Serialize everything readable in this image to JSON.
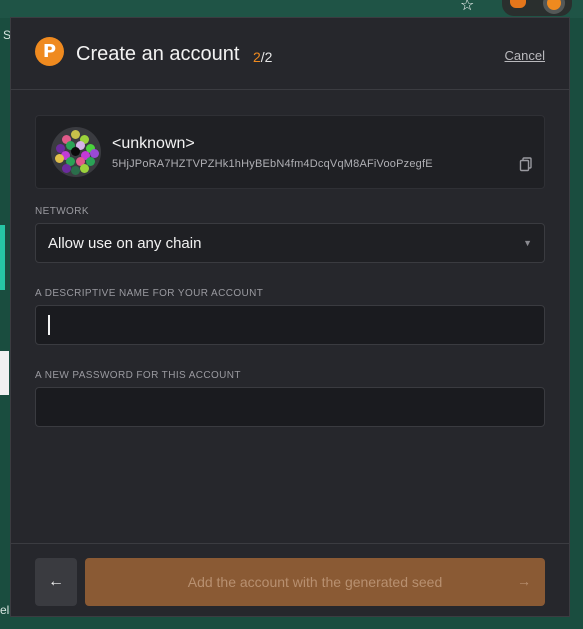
{
  "browser": {
    "bg_text_left": "S",
    "bg_text_bottom": "ela",
    "star_icon": "star-icon"
  },
  "header": {
    "title": "Create an account",
    "step_current": "2",
    "step_total": "/2",
    "cancel_label": "Cancel"
  },
  "account": {
    "name": "<unknown>",
    "address": "5HjJPoRA7HZTVPZHk1hHyBEbN4fm4DcqVqM8AFiVooPzegfE",
    "copy_icon": "copy-icon"
  },
  "network": {
    "label": "NETWORK",
    "selected": "Allow use on any chain"
  },
  "name_field": {
    "label": "A DESCRIPTIVE NAME FOR YOUR ACCOUNT",
    "value": ""
  },
  "password_field": {
    "label": "A NEW PASSWORD FOR THIS ACCOUNT",
    "value": ""
  },
  "footer": {
    "back_icon": "arrow-left-icon",
    "add_label": "Add the account with the generated seed",
    "add_icon": "arrow-right-icon"
  },
  "colors": {
    "accent": "#ef8a1f",
    "panel": "#26272c",
    "button_disabled": "#8a5a34"
  }
}
